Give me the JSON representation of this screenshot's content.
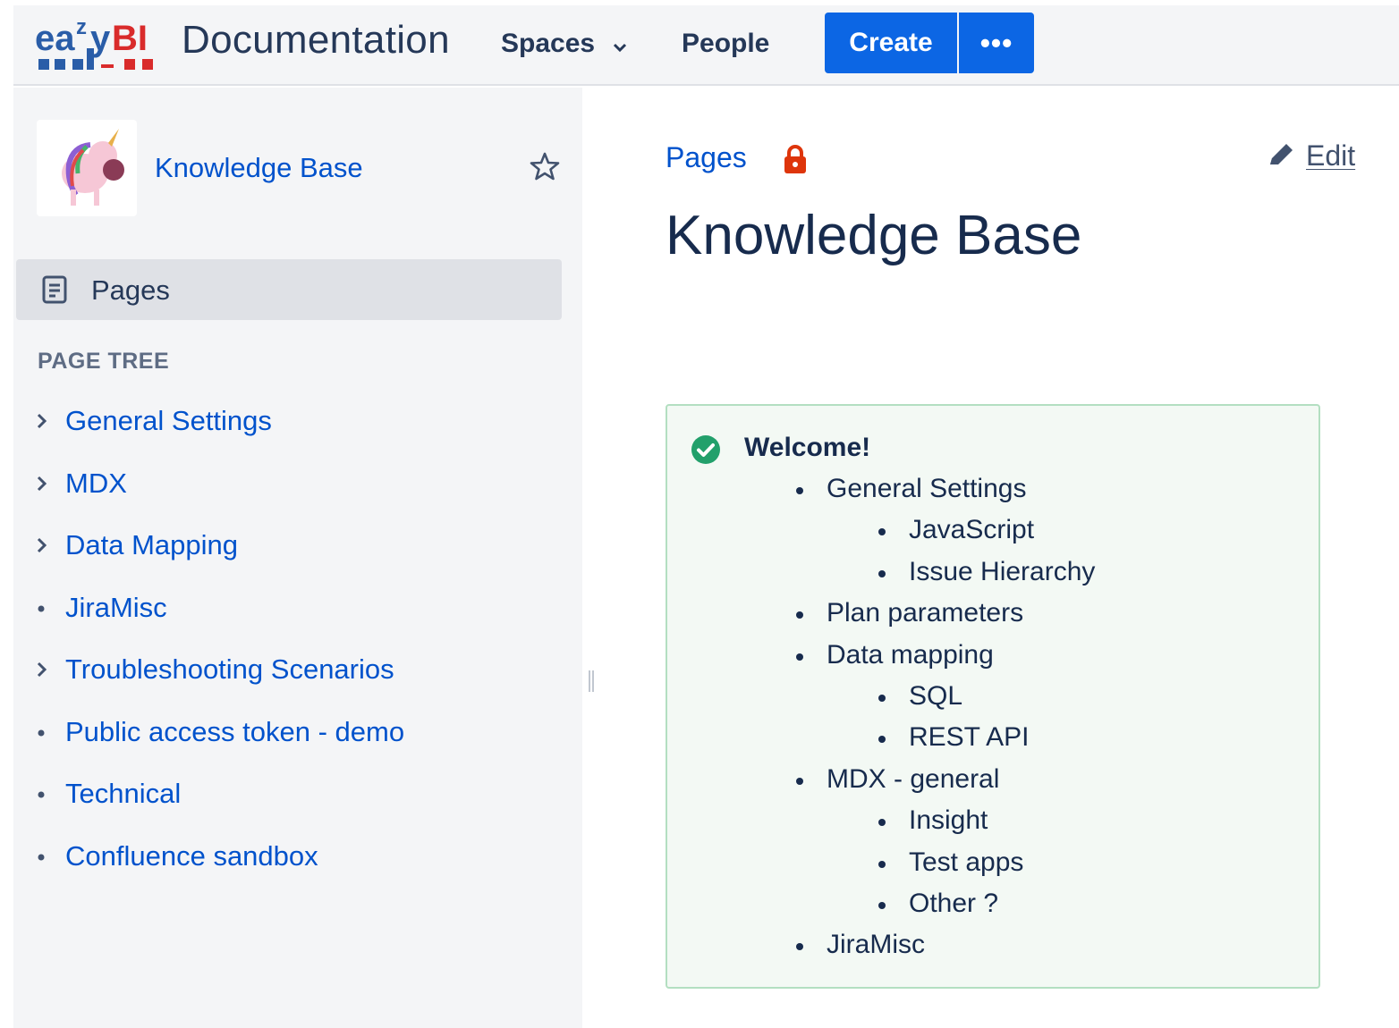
{
  "app": {
    "logo_text": "eazyBI",
    "title": "Documentation"
  },
  "nav": {
    "spaces_label": "Spaces",
    "people_label": "People",
    "create_label": "Create",
    "more_label": "•••"
  },
  "sidebar": {
    "space_name": "Knowledge Base",
    "pages_label": "Pages",
    "tree_heading": "PAGE TREE",
    "tree_items": [
      {
        "label": "General Settings",
        "marker": "chevron"
      },
      {
        "label": "MDX",
        "marker": "chevron"
      },
      {
        "label": "Data Mapping",
        "marker": "chevron"
      },
      {
        "label": "JiraMisc",
        "marker": "bullet"
      },
      {
        "label": "Troubleshooting Scenarios",
        "marker": "chevron"
      },
      {
        "label": "Public access token - demo",
        "marker": "bullet"
      },
      {
        "label": "Technical",
        "marker": "bullet"
      },
      {
        "label": "Confluence sandbox",
        "marker": "bullet"
      }
    ]
  },
  "content": {
    "breadcrumb": "Pages",
    "edit_label": "Edit",
    "title": "Knowledge Base",
    "panel": {
      "heading": "Welcome!",
      "items": [
        {
          "text": "General Settings",
          "level": 1
        },
        {
          "text": "JavaScript",
          "level": 2
        },
        {
          "text": "Issue Hierarchy",
          "level": 2
        },
        {
          "text": "Plan parameters",
          "level": 1
        },
        {
          "text": "Data mapping",
          "level": 1
        },
        {
          "text": "SQL",
          "level": 2
        },
        {
          "text": "REST API",
          "level": 2
        },
        {
          "text": "MDX - general",
          "level": 1
        },
        {
          "text": "Insight",
          "level": 2
        },
        {
          "text": "Test apps",
          "level": 2
        },
        {
          "text": "Other ?",
          "level": 2
        },
        {
          "text": "JiraMisc",
          "level": 1
        }
      ]
    }
  },
  "colors": {
    "primary": "#0c66e4",
    "link": "#0052cc",
    "success": "#22a06b",
    "lock": "#de350b"
  },
  "icons": [
    "eazybi-logo",
    "chevron-down-icon",
    "star-icon",
    "page-icon",
    "lock-icon",
    "pencil-icon",
    "check-circle-icon",
    "resize-handle-icon",
    "space-avatar"
  ]
}
